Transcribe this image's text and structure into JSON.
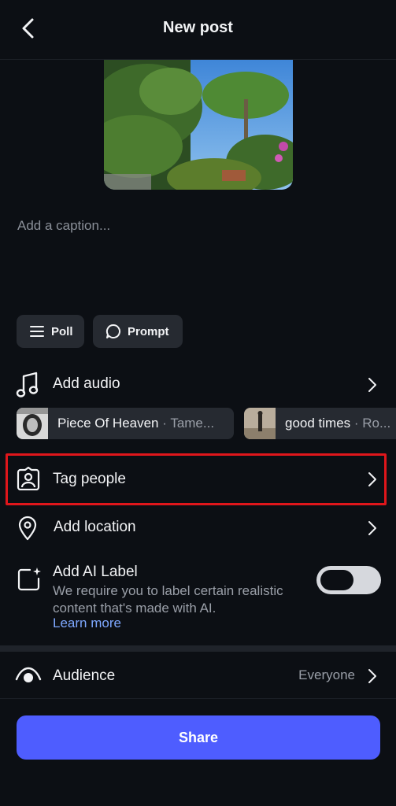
{
  "header": {
    "title": "New post",
    "back_icon": "chevron-left-icon"
  },
  "caption": {
    "placeholder": "Add a caption..."
  },
  "chips": [
    {
      "label": "Poll",
      "icon": "list-icon"
    },
    {
      "label": "Prompt",
      "icon": "speech-bubble-icon"
    }
  ],
  "audio": {
    "label": "Add audio",
    "icon": "music-note-icon",
    "suggestions": [
      {
        "title": "Piece Of Heaven",
        "artist": " · Tame..."
      },
      {
        "title": "good times",
        "artist": " · Ro..."
      }
    ]
  },
  "tag_people": {
    "label": "Tag people",
    "icon": "tag-person-icon"
  },
  "location": {
    "label": "Add location",
    "icon": "location-pin-icon"
  },
  "ai_label": {
    "label": "Add AI Label",
    "description": "We require you to label certain realistic content that's made with AI.",
    "learn_more": "Learn more",
    "enabled": false
  },
  "audience": {
    "label": "Audience",
    "value": "Everyone",
    "icon": "eye-icon"
  },
  "share": {
    "label": "Share"
  },
  "colors": {
    "accent": "#4e5dff",
    "link": "#7ea8ff",
    "highlight": "#e0161b",
    "background": "#0c0f14"
  }
}
